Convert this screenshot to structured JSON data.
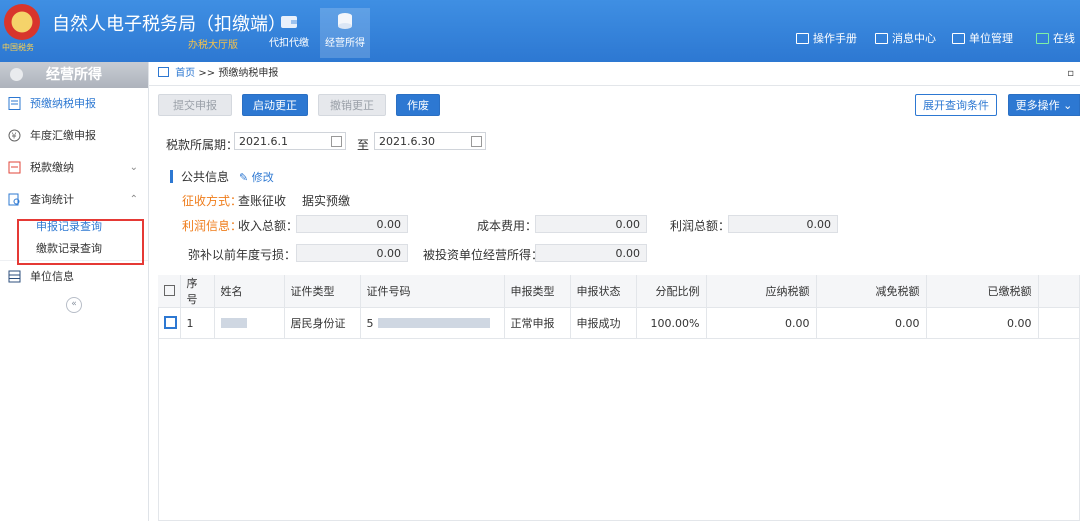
{
  "app": {
    "title": "自然人电子税务局（扣缴端）",
    "subtitle": "办税大厅版",
    "emblem_text": "中国税务"
  },
  "top_nav": [
    {
      "label": "代扣代缴",
      "icon": "wallet-icon"
    },
    {
      "label": "经营所得",
      "icon": "coins-icon",
      "active": true
    }
  ],
  "top_links": [
    {
      "label": "操作手册",
      "icon": "manual-icon"
    },
    {
      "label": "消息中心",
      "icon": "message-icon"
    },
    {
      "label": "单位管理",
      "icon": "unit-icon"
    },
    {
      "label": "在线",
      "icon": "online-icon"
    }
  ],
  "sidebar": {
    "header": "经营所得",
    "items": [
      {
        "label": "预缴纳税申报",
        "icon": "prepay-doc-icon",
        "active": true
      },
      {
        "label": "年度汇缴申报",
        "icon": "annual-icon"
      },
      {
        "label": "税款缴纳",
        "icon": "payment-icon",
        "chevron": "⌄"
      },
      {
        "label": "查询统计",
        "icon": "query-icon",
        "chevron": "⌃"
      },
      {
        "label": "单位信息",
        "icon": "unit-info-icon"
      }
    ],
    "sub_items": [
      "申报记录查询",
      "缴款记录查询"
    ],
    "collapse": "«"
  },
  "breadcrumb": {
    "home": "首页",
    "sep": ">>",
    "current": "预缴纳税申报",
    "close": "▫"
  },
  "toolbar": {
    "submit": "提交申报",
    "start_correction": "启动更正",
    "cancel_correction": "撤销更正",
    "void": "作废",
    "expand_query": "展开查询条件",
    "more_ops": "更多操作",
    "more_chevron": "⌄"
  },
  "period": {
    "label": "税款所属期：",
    "from": "2021.6.1",
    "to_label": "至",
    "to": "2021.6.30"
  },
  "public_info": {
    "title": "公共信息",
    "edit": "修改",
    "collection_label": "征收方式：",
    "collection_value": "查账征收",
    "prepay_value": "据实预缴",
    "profit_label": "利润信息：",
    "income_label": "收入总额：",
    "income": "0.00",
    "cost_label": "成本费用：",
    "cost": "0.00",
    "profit_total_label": "利润总额：",
    "profit_total": "0.00",
    "loss_label": "弥补以前年度亏损：",
    "loss": "0.00",
    "investee_label": "被投资单位经营所得：",
    "investee": "0.00"
  },
  "table": {
    "headers": [
      "序号",
      "姓名",
      "证件类型",
      "证件号码",
      "申报类型",
      "申报状态",
      "分配比例",
      "应纳税额",
      "减免税额",
      "已缴税额"
    ],
    "rows": [
      {
        "seq": "1",
        "name": "",
        "id_type": "居民身份证",
        "id_no": "5",
        "decl_type": "正常申报",
        "status": "申报成功",
        "ratio": "100.00%",
        "tax_due": "0.00",
        "tax_reduced": "0.00",
        "tax_paid": "0.00"
      }
    ]
  },
  "colors": {
    "primary": "#2d78d2",
    "orange": "#ef7d1c",
    "highlight_red": "#e53935"
  }
}
